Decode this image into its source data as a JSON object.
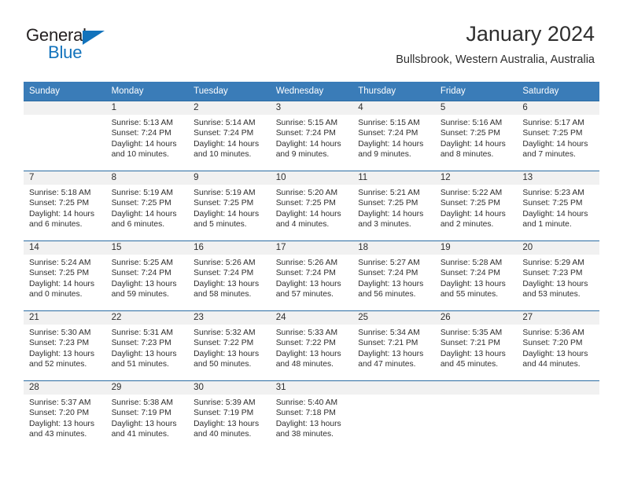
{
  "brand": {
    "name_part1": "General",
    "name_part2": "Blue",
    "logo_icon": "triangle-icon"
  },
  "header": {
    "title": "January 2024",
    "subtitle": "Bullsbrook, Western Australia, Australia"
  },
  "calendar": {
    "weekday_headers": [
      "Sunday",
      "Monday",
      "Tuesday",
      "Wednesday",
      "Thursday",
      "Friday",
      "Saturday"
    ],
    "accent_color": "#3a7cb8",
    "row_divider_color": "#2b6ca3",
    "daynum_bg": "#f1f1f1",
    "weeks": [
      [
        {
          "day": "",
          "sunrise": "",
          "sunset": "",
          "daylight_line1": "",
          "daylight_line2": ""
        },
        {
          "day": "1",
          "sunrise": "Sunrise: 5:13 AM",
          "sunset": "Sunset: 7:24 PM",
          "daylight_line1": "Daylight: 14 hours",
          "daylight_line2": "and 10 minutes."
        },
        {
          "day": "2",
          "sunrise": "Sunrise: 5:14 AM",
          "sunset": "Sunset: 7:24 PM",
          "daylight_line1": "Daylight: 14 hours",
          "daylight_line2": "and 10 minutes."
        },
        {
          "day": "3",
          "sunrise": "Sunrise: 5:15 AM",
          "sunset": "Sunset: 7:24 PM",
          "daylight_line1": "Daylight: 14 hours",
          "daylight_line2": "and 9 minutes."
        },
        {
          "day": "4",
          "sunrise": "Sunrise: 5:15 AM",
          "sunset": "Sunset: 7:24 PM",
          "daylight_line1": "Daylight: 14 hours",
          "daylight_line2": "and 9 minutes."
        },
        {
          "day": "5",
          "sunrise": "Sunrise: 5:16 AM",
          "sunset": "Sunset: 7:25 PM",
          "daylight_line1": "Daylight: 14 hours",
          "daylight_line2": "and 8 minutes."
        },
        {
          "day": "6",
          "sunrise": "Sunrise: 5:17 AM",
          "sunset": "Sunset: 7:25 PM",
          "daylight_line1": "Daylight: 14 hours",
          "daylight_line2": "and 7 minutes."
        }
      ],
      [
        {
          "day": "7",
          "sunrise": "Sunrise: 5:18 AM",
          "sunset": "Sunset: 7:25 PM",
          "daylight_line1": "Daylight: 14 hours",
          "daylight_line2": "and 6 minutes."
        },
        {
          "day": "8",
          "sunrise": "Sunrise: 5:19 AM",
          "sunset": "Sunset: 7:25 PM",
          "daylight_line1": "Daylight: 14 hours",
          "daylight_line2": "and 6 minutes."
        },
        {
          "day": "9",
          "sunrise": "Sunrise: 5:19 AM",
          "sunset": "Sunset: 7:25 PM",
          "daylight_line1": "Daylight: 14 hours",
          "daylight_line2": "and 5 minutes."
        },
        {
          "day": "10",
          "sunrise": "Sunrise: 5:20 AM",
          "sunset": "Sunset: 7:25 PM",
          "daylight_line1": "Daylight: 14 hours",
          "daylight_line2": "and 4 minutes."
        },
        {
          "day": "11",
          "sunrise": "Sunrise: 5:21 AM",
          "sunset": "Sunset: 7:25 PM",
          "daylight_line1": "Daylight: 14 hours",
          "daylight_line2": "and 3 minutes."
        },
        {
          "day": "12",
          "sunrise": "Sunrise: 5:22 AM",
          "sunset": "Sunset: 7:25 PM",
          "daylight_line1": "Daylight: 14 hours",
          "daylight_line2": "and 2 minutes."
        },
        {
          "day": "13",
          "sunrise": "Sunrise: 5:23 AM",
          "sunset": "Sunset: 7:25 PM",
          "daylight_line1": "Daylight: 14 hours",
          "daylight_line2": "and 1 minute."
        }
      ],
      [
        {
          "day": "14",
          "sunrise": "Sunrise: 5:24 AM",
          "sunset": "Sunset: 7:25 PM",
          "daylight_line1": "Daylight: 14 hours",
          "daylight_line2": "and 0 minutes."
        },
        {
          "day": "15",
          "sunrise": "Sunrise: 5:25 AM",
          "sunset": "Sunset: 7:24 PM",
          "daylight_line1": "Daylight: 13 hours",
          "daylight_line2": "and 59 minutes."
        },
        {
          "day": "16",
          "sunrise": "Sunrise: 5:26 AM",
          "sunset": "Sunset: 7:24 PM",
          "daylight_line1": "Daylight: 13 hours",
          "daylight_line2": "and 58 minutes."
        },
        {
          "day": "17",
          "sunrise": "Sunrise: 5:26 AM",
          "sunset": "Sunset: 7:24 PM",
          "daylight_line1": "Daylight: 13 hours",
          "daylight_line2": "and 57 minutes."
        },
        {
          "day": "18",
          "sunrise": "Sunrise: 5:27 AM",
          "sunset": "Sunset: 7:24 PM",
          "daylight_line1": "Daylight: 13 hours",
          "daylight_line2": "and 56 minutes."
        },
        {
          "day": "19",
          "sunrise": "Sunrise: 5:28 AM",
          "sunset": "Sunset: 7:24 PM",
          "daylight_line1": "Daylight: 13 hours",
          "daylight_line2": "and 55 minutes."
        },
        {
          "day": "20",
          "sunrise": "Sunrise: 5:29 AM",
          "sunset": "Sunset: 7:23 PM",
          "daylight_line1": "Daylight: 13 hours",
          "daylight_line2": "and 53 minutes."
        }
      ],
      [
        {
          "day": "21",
          "sunrise": "Sunrise: 5:30 AM",
          "sunset": "Sunset: 7:23 PM",
          "daylight_line1": "Daylight: 13 hours",
          "daylight_line2": "and 52 minutes."
        },
        {
          "day": "22",
          "sunrise": "Sunrise: 5:31 AM",
          "sunset": "Sunset: 7:23 PM",
          "daylight_line1": "Daylight: 13 hours",
          "daylight_line2": "and 51 minutes."
        },
        {
          "day": "23",
          "sunrise": "Sunrise: 5:32 AM",
          "sunset": "Sunset: 7:22 PM",
          "daylight_line1": "Daylight: 13 hours",
          "daylight_line2": "and 50 minutes."
        },
        {
          "day": "24",
          "sunrise": "Sunrise: 5:33 AM",
          "sunset": "Sunset: 7:22 PM",
          "daylight_line1": "Daylight: 13 hours",
          "daylight_line2": "and 48 minutes."
        },
        {
          "day": "25",
          "sunrise": "Sunrise: 5:34 AM",
          "sunset": "Sunset: 7:21 PM",
          "daylight_line1": "Daylight: 13 hours",
          "daylight_line2": "and 47 minutes."
        },
        {
          "day": "26",
          "sunrise": "Sunrise: 5:35 AM",
          "sunset": "Sunset: 7:21 PM",
          "daylight_line1": "Daylight: 13 hours",
          "daylight_line2": "and 45 minutes."
        },
        {
          "day": "27",
          "sunrise": "Sunrise: 5:36 AM",
          "sunset": "Sunset: 7:20 PM",
          "daylight_line1": "Daylight: 13 hours",
          "daylight_line2": "and 44 minutes."
        }
      ],
      [
        {
          "day": "28",
          "sunrise": "Sunrise: 5:37 AM",
          "sunset": "Sunset: 7:20 PM",
          "daylight_line1": "Daylight: 13 hours",
          "daylight_line2": "and 43 minutes."
        },
        {
          "day": "29",
          "sunrise": "Sunrise: 5:38 AM",
          "sunset": "Sunset: 7:19 PM",
          "daylight_line1": "Daylight: 13 hours",
          "daylight_line2": "and 41 minutes."
        },
        {
          "day": "30",
          "sunrise": "Sunrise: 5:39 AM",
          "sunset": "Sunset: 7:19 PM",
          "daylight_line1": "Daylight: 13 hours",
          "daylight_line2": "and 40 minutes."
        },
        {
          "day": "31",
          "sunrise": "Sunrise: 5:40 AM",
          "sunset": "Sunset: 7:18 PM",
          "daylight_line1": "Daylight: 13 hours",
          "daylight_line2": "and 38 minutes."
        },
        {
          "day": "",
          "sunrise": "",
          "sunset": "",
          "daylight_line1": "",
          "daylight_line2": ""
        },
        {
          "day": "",
          "sunrise": "",
          "sunset": "",
          "daylight_line1": "",
          "daylight_line2": ""
        },
        {
          "day": "",
          "sunrise": "",
          "sunset": "",
          "daylight_line1": "",
          "daylight_line2": ""
        }
      ]
    ]
  }
}
